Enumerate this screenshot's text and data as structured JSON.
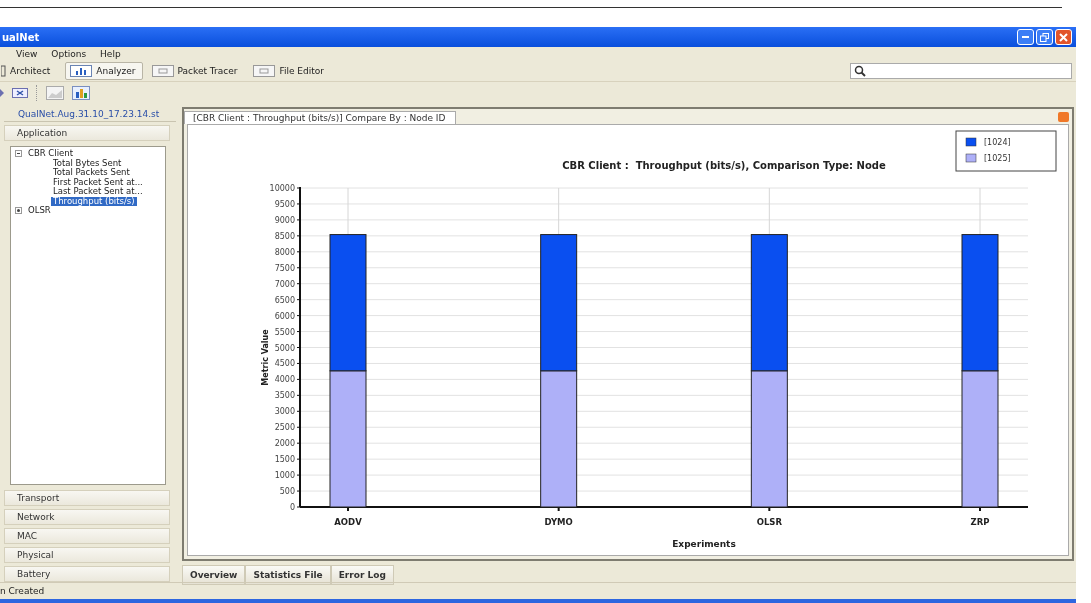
{
  "window": {
    "title": "ualNet"
  },
  "menu": [
    "View",
    "Options",
    "Help"
  ],
  "toolbar": [
    {
      "label": "Architect",
      "selected": false
    },
    {
      "label": "Analyzer",
      "selected": true
    },
    {
      "label": "Packet Tracer",
      "selected": false
    },
    {
      "label": "File Editor",
      "selected": false
    }
  ],
  "sidebar": {
    "header": "QualNet.Aug.31.10_17.23.14.st",
    "top_sections": [
      "Application"
    ],
    "tree": [
      {
        "label": "CBR Client",
        "expanded": true,
        "selected": false,
        "children": [
          {
            "label": "Total Bytes Sent",
            "selected": false
          },
          {
            "label": "Total Packets Sent",
            "selected": false
          },
          {
            "label": "First Packet Sent at...",
            "selected": false
          },
          {
            "label": "Last Packet Sent at...",
            "selected": false
          },
          {
            "label": "Throughput (bits/s)",
            "selected": true
          }
        ]
      },
      {
        "label": "OLSR",
        "expanded": false,
        "selected": false
      }
    ],
    "bottom_sections": [
      "Transport",
      "Network",
      "MAC",
      "Physical",
      "Battery"
    ]
  },
  "document_tab": "[CBR Client :  Throughput (bits/s)] Compare By : Node ID",
  "chart_data": {
    "type": "bar",
    "stacked": true,
    "title": "CBR Client :  Throughput (bits/s), Comparison Type: Node",
    "xlabel": "Experiments",
    "ylabel": "Metric Value",
    "categories": [
      "AODV",
      "DYMO",
      "OLSR",
      "ZRP"
    ],
    "series": [
      {
        "name": "[1024]",
        "color": "#0a4ff0",
        "values": [
          4270,
          4270,
          4270,
          4270
        ]
      },
      {
        "name": "[1025]",
        "color": "#aeb0f8",
        "values": [
          4270,
          4270,
          4270,
          4270
        ]
      }
    ],
    "ylim": [
      0,
      10000
    ],
    "grid": true,
    "legend": true,
    "yticks": [
      0,
      500,
      1000,
      1500,
      2000,
      2500,
      3000,
      3500,
      4000,
      4500,
      5000,
      5500,
      6000,
      6500,
      7000,
      7500,
      8000,
      8500,
      9000,
      9500,
      10000
    ]
  },
  "bottom_tabs": [
    {
      "label": "Overview",
      "selected": false
    },
    {
      "label": "Statistics File",
      "selected": false
    },
    {
      "label": "Error Log",
      "selected": false
    }
  ],
  "status_bar": "n Created"
}
